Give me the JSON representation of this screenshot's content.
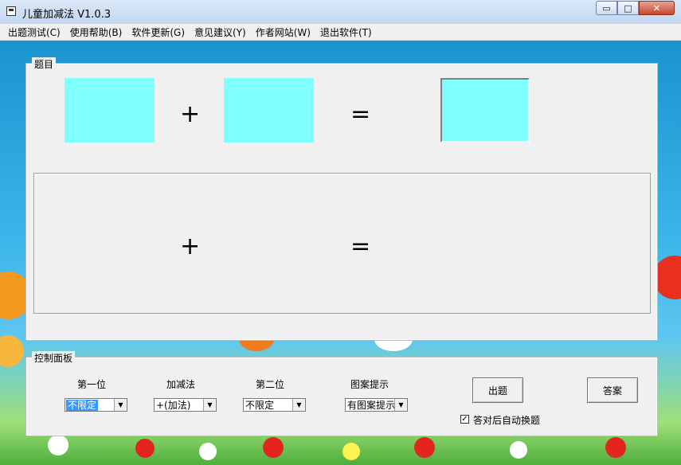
{
  "window": {
    "title": "儿童加减法 V1.0.3",
    "min_icon": "minimize-icon",
    "max_icon": "maximize-icon",
    "close_icon": "close-icon",
    "min_glyph": "▭",
    "max_glyph": "□",
    "close_glyph": "✕"
  },
  "menu": [
    {
      "label": "出题测试(C)"
    },
    {
      "label": "使用帮助(B)"
    },
    {
      "label": "软件更新(G)"
    },
    {
      "label": "意见建议(Y)"
    },
    {
      "label": "作者网站(W)"
    },
    {
      "label": "退出软件(T)"
    }
  ],
  "question": {
    "legend": "题目",
    "operator": "+",
    "equals": "=",
    "box_color": "#80ffff"
  },
  "hint": {
    "operator": "+",
    "equals": "="
  },
  "control": {
    "legend": "控制面板",
    "first_label": "第一位",
    "first_value": "不限定",
    "op_label": "加减法",
    "op_value": "+(加法)",
    "second_label": "第二位",
    "second_value": "不限定",
    "pattern_label": "图案提示",
    "pattern_value": "有图案提示",
    "generate_button": "出题",
    "answer_button": "答案",
    "auto_next_label": "答对后自动换题",
    "auto_next_checked": true,
    "check_glyph": "✓",
    "arrow_glyph": "▼"
  }
}
